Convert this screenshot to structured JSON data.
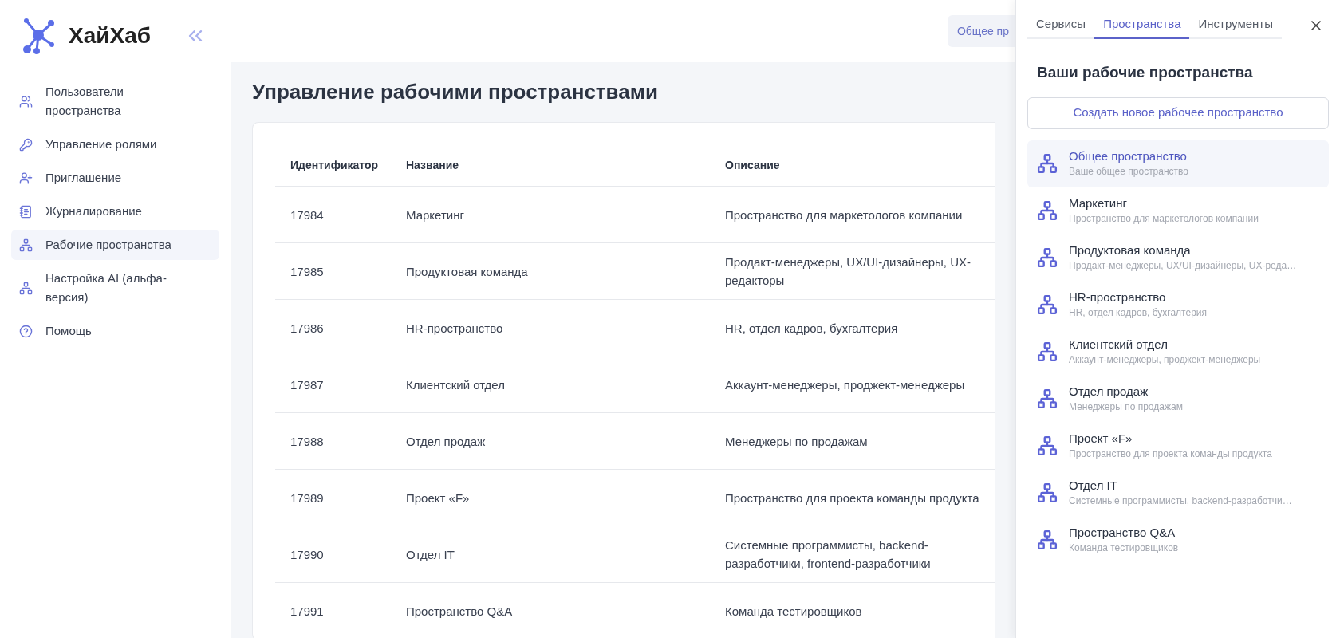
{
  "sidebar": {
    "logo": "ХайХаб",
    "items": [
      {
        "label": "Пользователи пространства",
        "selected": false
      },
      {
        "label": "Управление ролями",
        "selected": false
      },
      {
        "label": "Приглашение",
        "selected": false
      },
      {
        "label": "Журналирование",
        "selected": false
      },
      {
        "label": "Рабочие пространства",
        "selected": true
      },
      {
        "label": "Настройка AI (альфа-версия)",
        "selected": false
      },
      {
        "label": "Помощь",
        "selected": false
      }
    ]
  },
  "header": {
    "workspace_button": "Общее пр"
  },
  "page_title": "Управление рабочими пространствами",
  "table": {
    "columns": [
      "Идентификатор",
      "Название",
      "Описание"
    ],
    "rows": [
      [
        "17984",
        "Маркетинг",
        "Пространство для маркетологов компании"
      ],
      [
        "17985",
        "Продуктовая команда",
        "Продакт-менеджеры, UX/UI-дизайнеры, UX-редакторы"
      ],
      [
        "17986",
        "HR-пространство",
        "HR, отдел кадров, бухгалтерия"
      ],
      [
        "17987",
        "Клиентский отдел",
        "Аккаунт-менеджеры, проджект-менеджеры"
      ],
      [
        "17988",
        "Отдел продаж",
        "Менеджеры по продажам"
      ],
      [
        "17989",
        "Проект «F»",
        "Пространство для проекта команды продукта"
      ],
      [
        "17990",
        "Отдел IT",
        "Системные программисты, backend-разработчики, frontend-разработчики"
      ],
      [
        "17991",
        "Пространство Q&A",
        "Команда тестировщиков"
      ]
    ]
  },
  "panel": {
    "tabs": [
      {
        "label": "Сервисы",
        "selected": false
      },
      {
        "label": "Пространства",
        "selected": true
      },
      {
        "label": "Инструменты",
        "selected": false
      }
    ],
    "heading": "Ваши рабочие пространства",
    "create_button": "Создать новое рабочее пространство",
    "workspaces": [
      {
        "name": "Общее пространство",
        "description": "Ваше общее пространство",
        "selected": true
      },
      {
        "name": "Маркетинг",
        "description": "Пространство для маркетологов компании",
        "selected": false
      },
      {
        "name": "Продуктовая команда",
        "description": "Продакт-менеджеры, UX/UI-дизайнеры, UX-реда…",
        "selected": false
      },
      {
        "name": "HR-пространство",
        "description": "HR, отдел кадров, бухгалтерия",
        "selected": false
      },
      {
        "name": "Клиентский отдел",
        "description": "Аккаунт-менеджеры, проджект-менеджеры",
        "selected": false
      },
      {
        "name": "Отдел продаж",
        "description": "Менеджеры по продажам",
        "selected": false
      },
      {
        "name": "Проект «F»",
        "description": "Пространство для проекта команды продукта",
        "selected": false
      },
      {
        "name": "Отдел IT",
        "description": "Системные программисты, backend-разработчи…",
        "selected": false
      },
      {
        "name": "Пространство Q&A",
        "description": "Команда тестировщиков",
        "selected": false
      }
    ]
  }
}
